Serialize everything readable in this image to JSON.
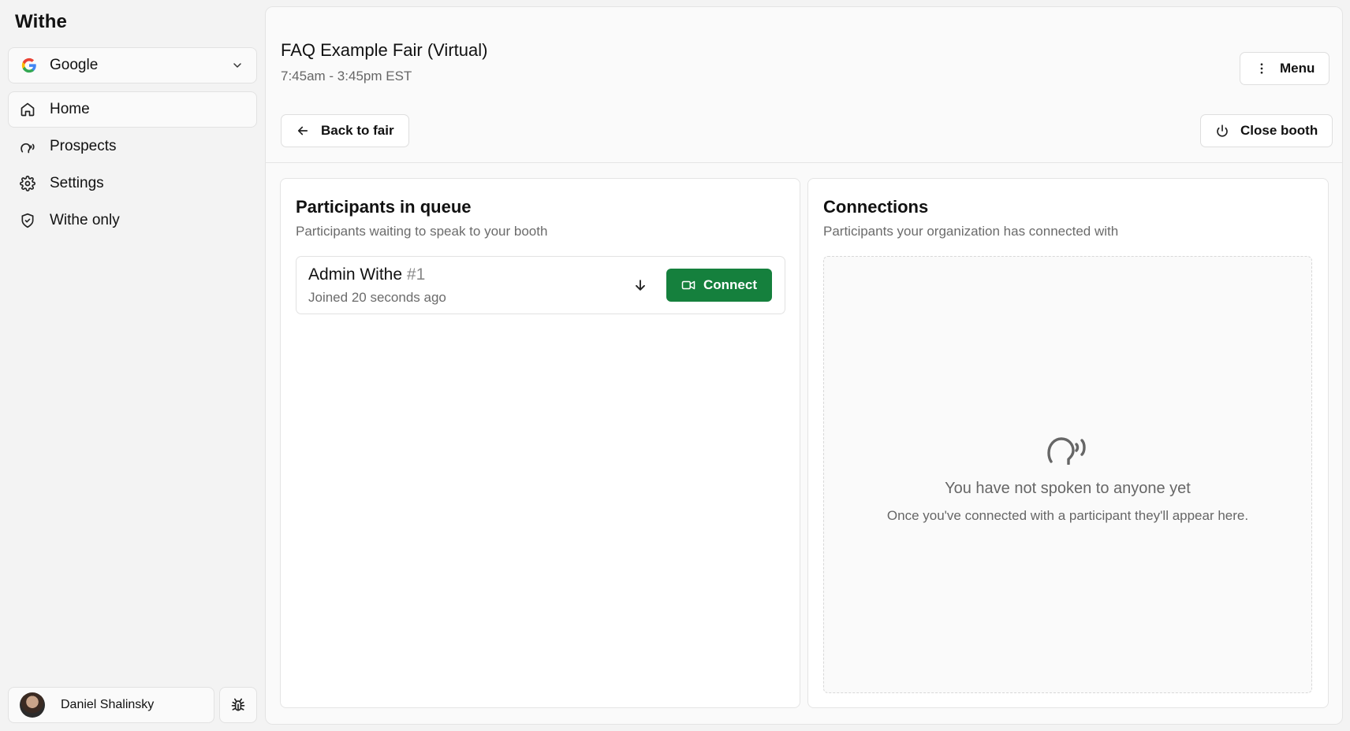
{
  "app": {
    "brand": "Withe"
  },
  "sidebar": {
    "org": {
      "label": "Google"
    },
    "items": [
      {
        "label": "Home",
        "icon": "home-icon",
        "active": true
      },
      {
        "label": "Prospects",
        "icon": "speaking-head-icon",
        "active": false
      },
      {
        "label": "Settings",
        "icon": "gear-icon",
        "active": false
      },
      {
        "label": "Withe only",
        "icon": "shield-icon",
        "active": false
      }
    ],
    "user": {
      "name": "Daniel Shalinsky"
    }
  },
  "header": {
    "title": "FAQ Example Fair (Virtual)",
    "time": "7:45am - 3:45pm EST",
    "menu_label": "Menu",
    "back_label": "Back to fair",
    "close_label": "Close booth"
  },
  "queue": {
    "title": "Participants in queue",
    "subtitle": "Participants waiting to speak to your booth",
    "items": [
      {
        "name": "Admin Withe",
        "number": "#1",
        "joined": "Joined 20 seconds ago",
        "connect_label": "Connect"
      }
    ]
  },
  "connections": {
    "title": "Connections",
    "subtitle": "Participants your organization has connected with",
    "empty_title": "You have not spoken to anyone yet",
    "empty_subtitle": "Once you've connected with a participant they'll appear here."
  },
  "colors": {
    "accent": "#15803d"
  }
}
